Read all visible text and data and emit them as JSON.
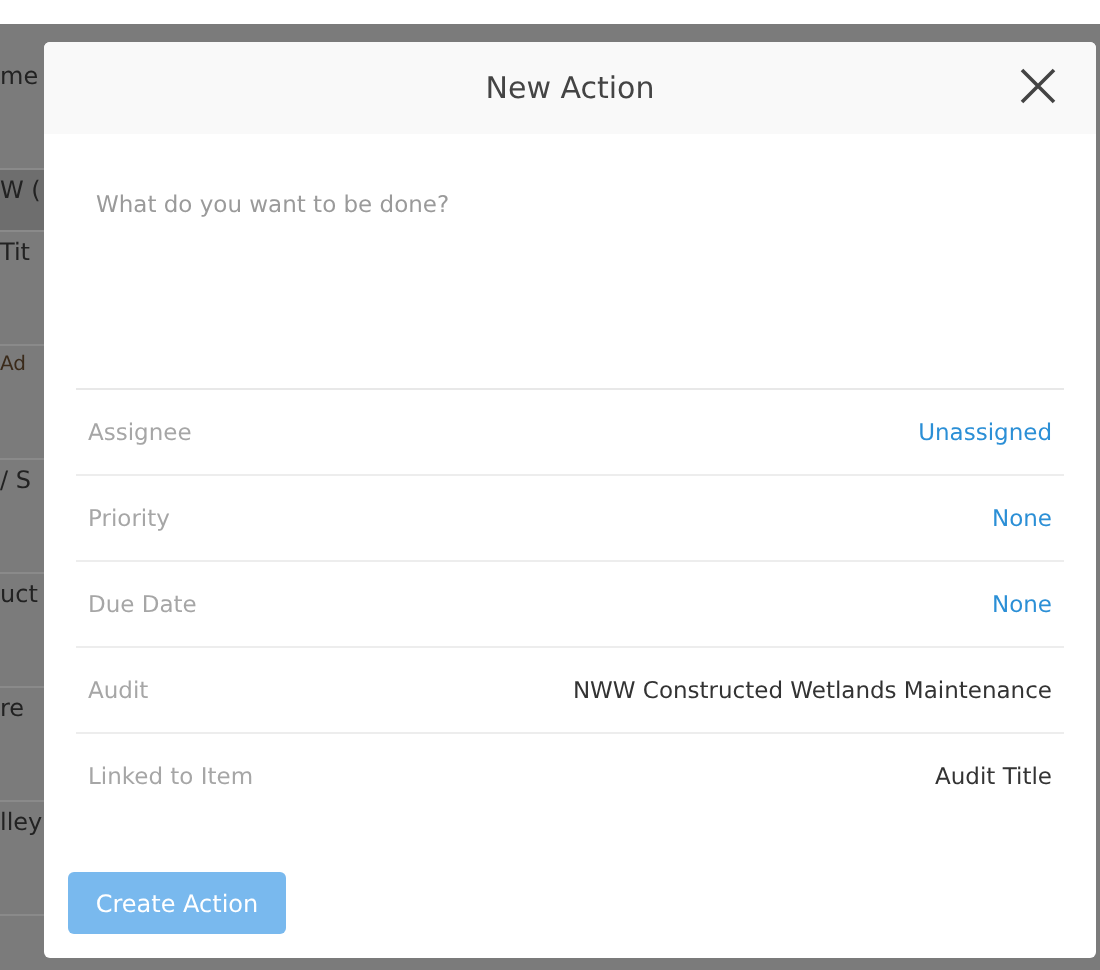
{
  "background": {
    "fragments": [
      {
        "text": "me",
        "kind": "label"
      },
      {
        "text": "W (",
        "kind": "field"
      },
      {
        "text": "Tit",
        "kind": "label"
      },
      {
        "text": "Ad",
        "kind": "small"
      },
      {
        "text": "/ S",
        "kind": "label"
      },
      {
        "text": "uct",
        "kind": "label"
      },
      {
        "text": "re",
        "kind": "label"
      },
      {
        "text": "lley",
        "kind": "label"
      }
    ]
  },
  "dialog": {
    "title": "New Action",
    "description": {
      "placeholder": "What do you want to be done?"
    },
    "fields": [
      {
        "label": "Assignee",
        "value": "Unassigned",
        "kind": "link"
      },
      {
        "label": "Priority",
        "value": "None",
        "kind": "link"
      },
      {
        "label": "Due Date",
        "value": "None",
        "kind": "link"
      },
      {
        "label": "Audit",
        "value": "NWW Constructed Wetlands Maintenance",
        "kind": "text"
      },
      {
        "label": "Linked to Item",
        "value": "Audit Title",
        "kind": "text"
      }
    ],
    "submit_button": {
      "label": "Create Action",
      "disabled": true
    }
  }
}
